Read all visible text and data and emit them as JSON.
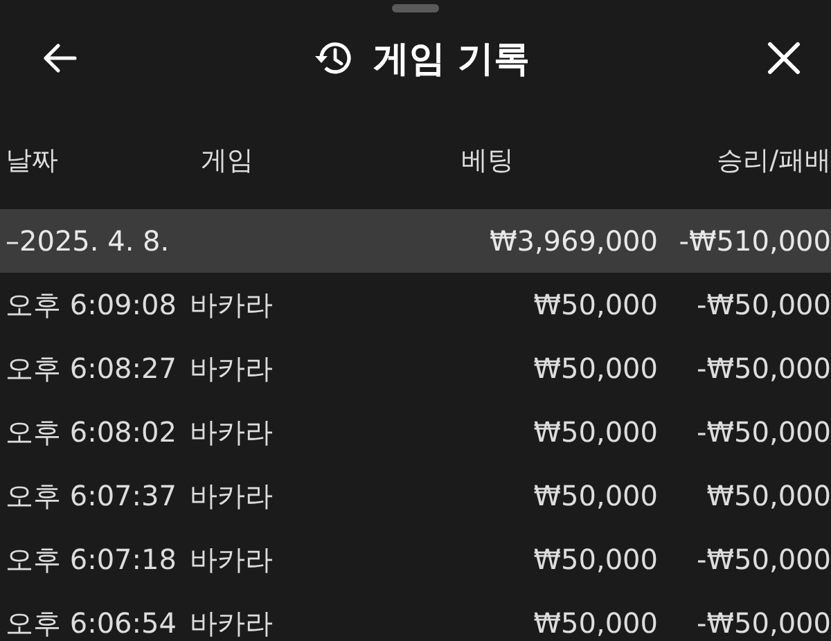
{
  "header": {
    "title": "게임 기록"
  },
  "table": {
    "columns": [
      "날짜",
      "게임",
      "베팅",
      "승리/패배"
    ],
    "group": {
      "date": "–2025. 4. 8.",
      "bet": "₩3,969,000",
      "result": "-₩510,000"
    },
    "rows": [
      {
        "time": "오후 6:09:08",
        "game": "바카라",
        "bet": "₩50,000",
        "result": "-₩50,000"
      },
      {
        "time": "오후 6:08:27",
        "game": "바카라",
        "bet": "₩50,000",
        "result": "-₩50,000"
      },
      {
        "time": "오후 6:08:02",
        "game": "바카라",
        "bet": "₩50,000",
        "result": "-₩50,000"
      },
      {
        "time": "오후 6:07:37",
        "game": "바카라",
        "bet": "₩50,000",
        "result": "₩50,000"
      },
      {
        "time": "오후 6:07:18",
        "game": "바카라",
        "bet": "₩50,000",
        "result": "-₩50,000"
      },
      {
        "time": "오후 6:06:54",
        "game": "바카라",
        "bet": "₩50,000",
        "result": "-₩50,000"
      }
    ]
  }
}
